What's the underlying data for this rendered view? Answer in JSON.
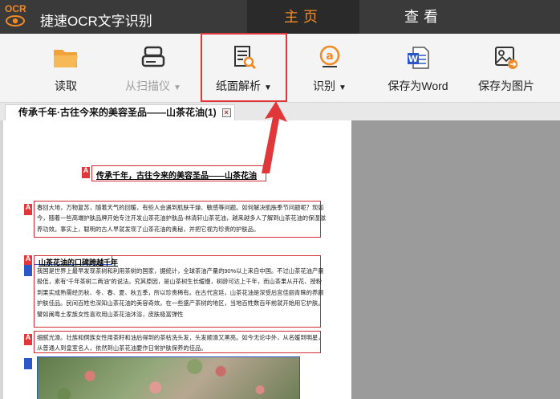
{
  "app": {
    "title": "捷速OCR文字识别",
    "logo_text": "OCR"
  },
  "nav_tabs": [
    {
      "label": "主页",
      "active": true
    },
    {
      "label": "查看",
      "active": false
    }
  ],
  "toolbar": {
    "open": {
      "label": "读取",
      "icon": "folder-icon"
    },
    "scan": {
      "label": "从扫描仪",
      "caret": "▼",
      "icon": "scanner-icon",
      "disabled": true
    },
    "parse": {
      "label": "纸面解析",
      "caret": "▼",
      "icon": "document-search-icon"
    },
    "recognize": {
      "label": "识别",
      "caret": "▼",
      "icon": "recognize-icon"
    },
    "save_word": {
      "label": "保存为Word",
      "icon": "word-icon"
    },
    "save_image": {
      "label": "保存为图片",
      "icon": "image-export-icon"
    }
  },
  "document_tab": {
    "title": "传承千年·古往今来的美容圣品——山茶花油(1)",
    "close": "×"
  },
  "page": {
    "marker_text": "A",
    "title": "传承千年，古往今来的美容圣品——山茶花油",
    "paragraph1": "春回大地，万物复苏，随着天气的回暖，有些人会遇到肌肤干燥、敏感等问题。如何解决肌肤季节问题呢？现如今，随着一些高端护肤品牌开始专注开发山茶花油护肤品-林清轩山茶花油，越来越多人了解到山茶花油的保湿滋养功效。事实上，聪明的古人早就发现了山茶花油的奥秘，并把它视为珍贵的护肤品。",
    "heading2": "山茶花油的口碑跨越千年",
    "paragraph2": "我国是世界上最早发现茶树和利用茶树的国家，据统计，全球茶油产量的90%以上来自中国。不过山茶花油产量极低，素有“千年茶树二两油”的说法。究其原因，是山茶树生长缓慢，树龄可达上千年，而山茶果从开花、授粉到果实成熟需经历秋、冬、春、夏、秋五季，所以珍贵稀有。在古代宫廷，山茶花油是深受后宫佳丽青睐的养颜护肤佳品。民间百姓也深知山茶花油的美容奇效。在一些盛产茶树的地区，当地百姓数百年前就开始用它护肤。譬如闽粤土家族女性喜欢用山茶花油沐浴，皮肤极富弹性",
    "paragraph3": "细腻光滑。壮族和侗族女性用茶籽和油后得到的茶枯洗头发，头发顺滑又黑亮。如今无论中外，从名媛到明星，从普通人到皇室名人，依然到山茶花油要作日常护肤保养的佳品。"
  },
  "colors": {
    "accent_orange": "#f08a24",
    "highlight_red": "#e0373a",
    "titlebar": "#3a3a3a",
    "region_blue": "#2b57c8"
  }
}
